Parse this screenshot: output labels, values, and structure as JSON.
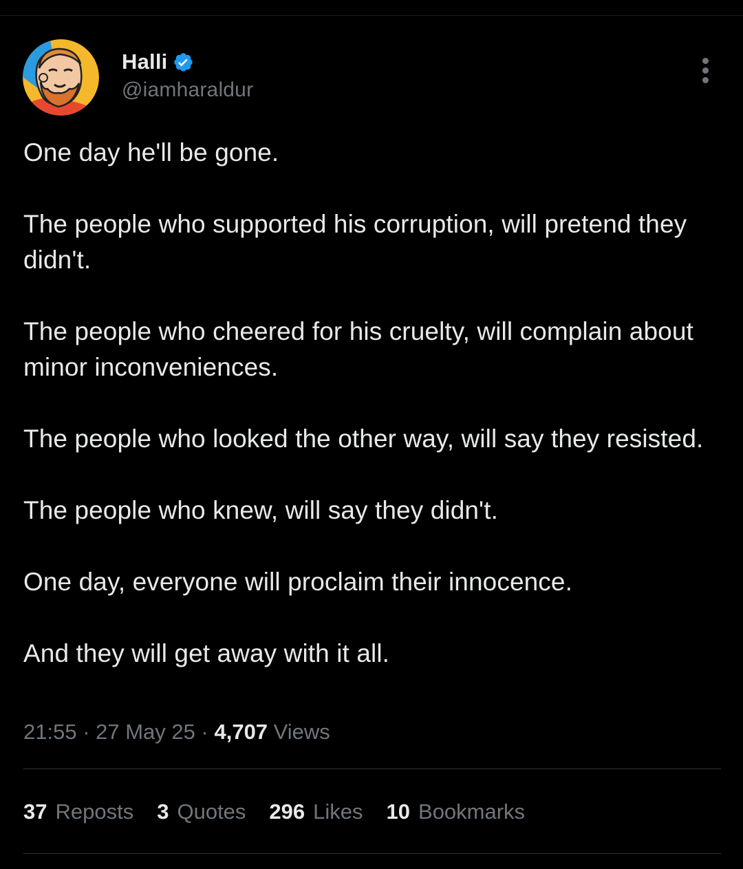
{
  "author": {
    "display_name": "Halli",
    "handle": "@iamharaldur",
    "verified": true
  },
  "tweet": {
    "paragraphs": [
      "One day he'll be gone.",
      "The people who supported his corruption, will pretend they didn't.",
      "The people who cheered for his cruelty, will complain about minor inconveniences.",
      "The people who looked the other way, will say they resisted.",
      "The people who knew, will say they didn't.",
      "One day, everyone will proclaim their innocence.",
      "And they will get away with it all."
    ],
    "time": "21:55",
    "separator": " · ",
    "date": "27 May 25",
    "views_count": "4,707",
    "views_label": "Views"
  },
  "stats": {
    "reposts": {
      "count": "37",
      "label": "Reposts"
    },
    "quotes": {
      "count": "3",
      "label": "Quotes"
    },
    "likes": {
      "count": "296",
      "label": "Likes"
    },
    "bookmarks": {
      "count": "10",
      "label": "Bookmarks"
    }
  },
  "icons": {
    "verified": "verified-badge-icon",
    "more": "more-vertical-icon"
  },
  "colors": {
    "background": "#000000",
    "text_primary": "#e7e9ea",
    "text_secondary": "#71767b",
    "verified_blue": "#1d9bf0",
    "divider": "#2f3336"
  }
}
